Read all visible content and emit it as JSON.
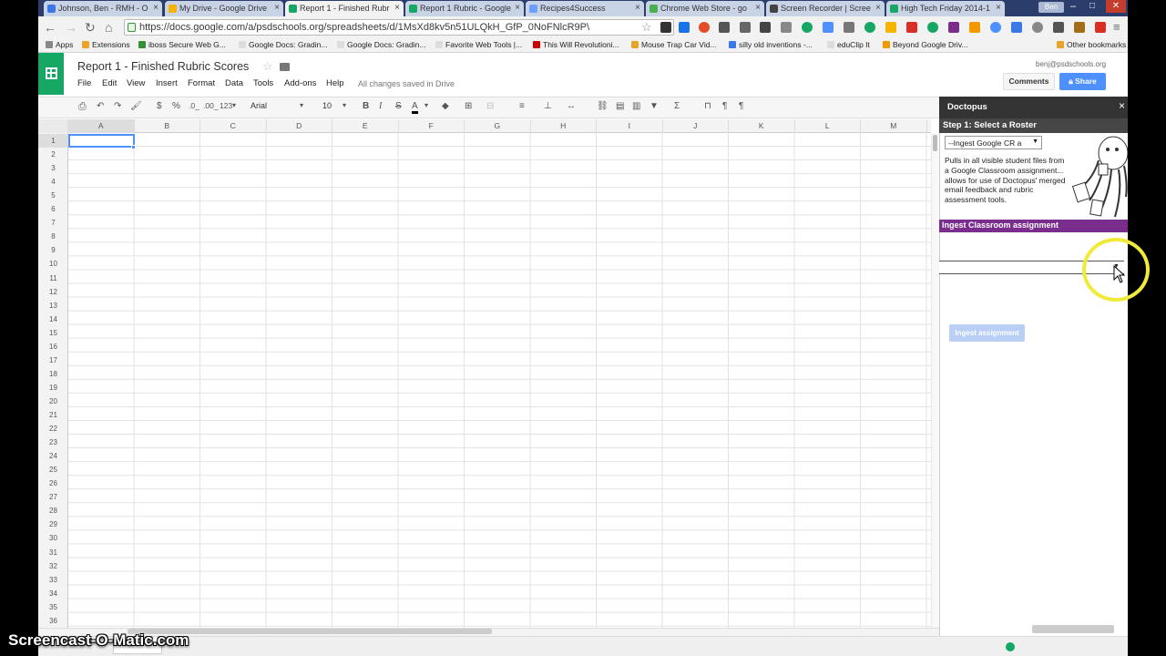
{
  "browser": {
    "tabs": [
      {
        "title": "Johnson, Ben - RMH - O",
        "icon_color": "#3b78e7",
        "active": false
      },
      {
        "title": "My Drive - Google Drive",
        "icon_color": "#f4b400",
        "active": false
      },
      {
        "title": "Report 1 - Finished Rubr",
        "icon_color": "#16a765",
        "active": true
      },
      {
        "title": "Report 1 Rubric - Google",
        "icon_color": "#16a765",
        "active": false
      },
      {
        "title": "Recipes4Success",
        "icon_color": "#6aa0ff",
        "active": false
      },
      {
        "title": "Chrome Web Store - go",
        "icon_color": "#4caf50",
        "active": false
      },
      {
        "title": "Screen Recorder | Scree",
        "icon_color": "#444444",
        "active": false
      },
      {
        "title": "High Tech Friday 2014-1",
        "icon_color": "#16a765",
        "active": false
      }
    ],
    "window_user": "Ben",
    "url": "https://docs.google.com/a/psdschools.org/spreadsheets/d/1MsXd8kv5n51ULQkH_GfP_0NoFNlcR9P\\",
    "bookmarks": [
      "Apps",
      "Extensions",
      "iboss Secure Web G...",
      "Google Docs: Gradin...",
      "Google Docs: Gradin...",
      "Favorite Web Tools |...",
      "This Will Revolutioni...",
      "Mouse Trap Car Vid...",
      "silly old inventions -...",
      "eduClip It",
      "Beyond Google Driv...",
      "Other bookmarks"
    ]
  },
  "doc": {
    "title": "Report 1 - Finished Rubric Scores",
    "menus": [
      "File",
      "Edit",
      "View",
      "Insert",
      "Format",
      "Data",
      "Tools",
      "Add-ons",
      "Help"
    ],
    "save_status": "All changes saved in Drive",
    "account": "benj@psdschools.org",
    "comments_label": "Comments",
    "share_label": "Share",
    "toolbar": {
      "currency": "$",
      "percent": "%",
      "dec_less": ".0_",
      "dec_more": ".00_",
      "number_format": "123",
      "font": "Arial",
      "font_size": "10",
      "bold": "B",
      "italic": "I",
      "strike": "S",
      "text_color": "A",
      "sum": "Σ"
    }
  },
  "sheet": {
    "columns": [
      "A",
      "B",
      "C",
      "D",
      "E",
      "F",
      "G",
      "H",
      "I",
      "J",
      "K",
      "L",
      "M"
    ],
    "rows": [
      "1",
      "2",
      "3",
      "4",
      "5",
      "6",
      "7",
      "8",
      "9",
      "10",
      "11",
      "12",
      "13",
      "14",
      "15",
      "16",
      "17",
      "18",
      "19",
      "20",
      "21",
      "22",
      "23",
      "24",
      "25",
      "26",
      "27",
      "28",
      "29",
      "30",
      "31",
      "32",
      "33",
      "34",
      "35",
      "36"
    ],
    "selected_cell": "A1"
  },
  "sidebar": {
    "title": "Doctopus",
    "close": "×",
    "step1": "Step 1: Select a Roster",
    "roster_value": "--Ingest Google CR a",
    "description": "Pulls in all visible student files from a Google Classroom assignment... allows for use of Doctopus' merged email feedback and rubric assessment tools.",
    "ingest_header": "Ingest Classroom assignment",
    "ingest_button": "Ingest assignment"
  },
  "watermark": "Screencast-O-Matic.com"
}
